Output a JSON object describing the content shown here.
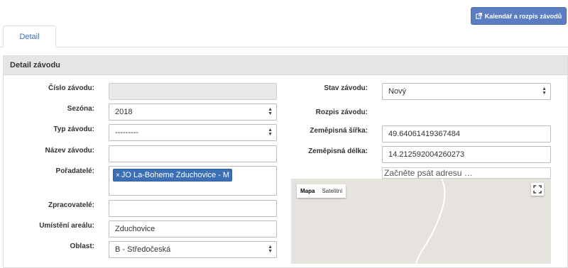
{
  "header": {
    "calendar_button_label": "Kalendář a rozpis závodů"
  },
  "tabs": [
    {
      "label": "Detail"
    }
  ],
  "panel": {
    "title": "Detail závodu"
  },
  "form": {
    "cislo": {
      "label": "Číslo závodu:",
      "value": ""
    },
    "sezona": {
      "label": "Sezóna:",
      "value": "2018"
    },
    "typ": {
      "label": "Typ závodu:",
      "value": "---------"
    },
    "nazev": {
      "label": "Název závodu:",
      "value": ""
    },
    "poradatele": {
      "label": "Pořadatelé:",
      "tag_remove": "×",
      "tags": [
        "JO La-Boheme Zduchovice - M"
      ]
    },
    "zpracovatele": {
      "label": "Zpracovatelé:",
      "value": ""
    },
    "umisteni": {
      "label": "Umístění areálu:",
      "value": "Zduchovice"
    },
    "oblast": {
      "label": "Oblast:",
      "value": "B - Středočeská"
    },
    "stav": {
      "label": "Stav závodu:",
      "value": "Nový"
    },
    "rozpis": {
      "label": "Rozpis závodu:",
      "value": ""
    },
    "sirka": {
      "label": "Zeměpisná šířka:",
      "value": "49.64061419367484"
    },
    "delka": {
      "label": "Zeměpisná délka:",
      "value": "14.212592004260273"
    }
  },
  "map": {
    "address_placeholder": "Začněte psát adresu …",
    "type_map": "Mapa",
    "type_satellite": "Satelitní"
  },
  "icons": {
    "external_link": "external-link-icon",
    "fullscreen": "fullscreen-icon",
    "select_arrows": "updown-arrows-icon"
  },
  "colors": {
    "primary_button": "#5b7ec2",
    "tab_text": "#3b6fb6",
    "tag": "#3d6fb5",
    "panel_header": "#e5e5e5",
    "map_bg": "#e6e3df"
  }
}
